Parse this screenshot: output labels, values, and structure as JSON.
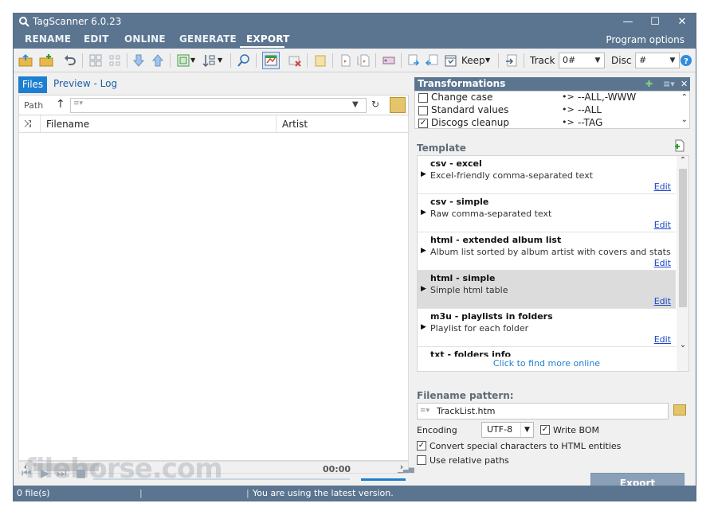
{
  "titlebar": {
    "title": "TagScanner 6.0.23",
    "minimize": "—",
    "maximize": "☐",
    "close": "✕"
  },
  "menu": {
    "items": [
      "RENAME",
      "EDIT",
      "ONLINE",
      "GENERATE",
      "EXPORT"
    ],
    "active": "EXPORT",
    "program_options": "Program options"
  },
  "toolbar": {
    "keep_label": "Keep",
    "track_label": "Track",
    "track_value": "0#",
    "disc_label": "Disc",
    "disc_value": "#"
  },
  "left": {
    "tab_files": "Files",
    "tab_preview_log": "Preview - Log",
    "path_label": "Path",
    "columns": [
      "Filename",
      "Artist"
    ]
  },
  "player": {
    "time": "00:00",
    "watermark": "filehorse.com"
  },
  "transformations": {
    "title": "Transformations",
    "rows": [
      {
        "checked": false,
        "name": "Change case",
        "arrow": "•>",
        "value": "--ALL,-WWW"
      },
      {
        "checked": false,
        "name": "Standard values",
        "arrow": "•>",
        "value": "--ALL"
      },
      {
        "checked": true,
        "name": "Discogs cleanup",
        "arrow": "•>",
        "value": "--TAG"
      }
    ]
  },
  "template": {
    "title": "Template",
    "items": [
      {
        "name": "csv - excel",
        "desc": "Excel-friendly comma-separated text",
        "edit": "Edit",
        "selected": false
      },
      {
        "name": "csv - simple",
        "desc": "Raw comma-separated text",
        "edit": "Edit",
        "selected": false
      },
      {
        "name": "html - extended album list",
        "desc": "Album list sorted by album artist with covers and stats",
        "edit": "Edit",
        "selected": false
      },
      {
        "name": "html - simple",
        "desc": "Simple html table",
        "edit": "Edit",
        "selected": true
      },
      {
        "name": "m3u - playlists in folders",
        "desc": "Playlist for each folder",
        "edit": "Edit",
        "selected": false
      },
      {
        "name": "txt - folders info",
        "desc": "",
        "edit": "",
        "selected": false
      }
    ],
    "more_link": "Click to find more online"
  },
  "filename": {
    "label": "Filename pattern:",
    "value": "TrackList.htm"
  },
  "encoding": {
    "label": "Encoding",
    "value": "UTF-8",
    "write_bom_label": "Write BOM",
    "write_bom": true
  },
  "options": {
    "convert_label": "Convert special characters to HTML entities",
    "convert": true,
    "relative_label": "Use relative paths",
    "relative": false
  },
  "export_button": "Export",
  "status": {
    "files": "0 file(s)",
    "message": "You are using the latest version."
  },
  "colors": {
    "accent": "#5b7590",
    "tab_active": "#1e7fd0",
    "link": "#1a46c7"
  }
}
